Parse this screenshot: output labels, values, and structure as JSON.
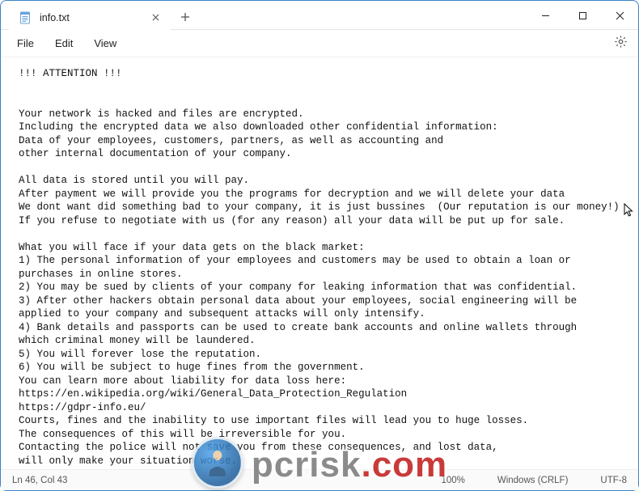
{
  "window": {
    "tab_title": "info.txt"
  },
  "menu": {
    "file": "File",
    "edit": "Edit",
    "view": "View"
  },
  "body_text": "!!! ATTENTION !!!\n\n\nYour network is hacked and files are encrypted.\nIncluding the encrypted data we also downloaded other confidential information:\nData of your employees, customers, partners, as well as accounting and\nother internal documentation of your company.\n\nAll data is stored until you will pay.\nAfter payment we will provide you the programs for decryption and we will delete your data\nWe dont want did something bad to your company, it is just bussines  (Our reputation is our money!)\nIf you refuse to negotiate with us (for any reason) all your data will be put up for sale.\n\nWhat you will face if your data gets on the black market:\n1) The personal information of your employees and customers may be used to obtain a loan or\npurchases in online stores.\n2) You may be sued by clients of your company for leaking information that was confidential.\n3) After other hackers obtain personal data about your employees, social engineering will be\napplied to your company and subsequent attacks will only intensify.\n4) Bank details and passports can be used to create bank accounts and online wallets through\nwhich criminal money will be laundered.\n5) You will forever lose the reputation.\n6) You will be subject to huge fines from the government.\nYou can learn more about liability for data loss here:\nhttps://en.wikipedia.org/wiki/General_Data_Protection_Regulation\nhttps://gdpr-info.eu/\nCourts, fines and the inability to use important files will lead you to huge losses.\nThe consequences of this will be irreversible for you.\nContacting the police will not save you from these consequences, and lost data,\nwill only make your situation worse.\n",
  "status": {
    "position": "Ln 46, Col 43",
    "zoom": "100%",
    "line_ending": "Windows (CRLF)",
    "encoding": "UTF-8"
  },
  "watermark": {
    "part1": "pcrisk",
    "part2": ".com"
  }
}
